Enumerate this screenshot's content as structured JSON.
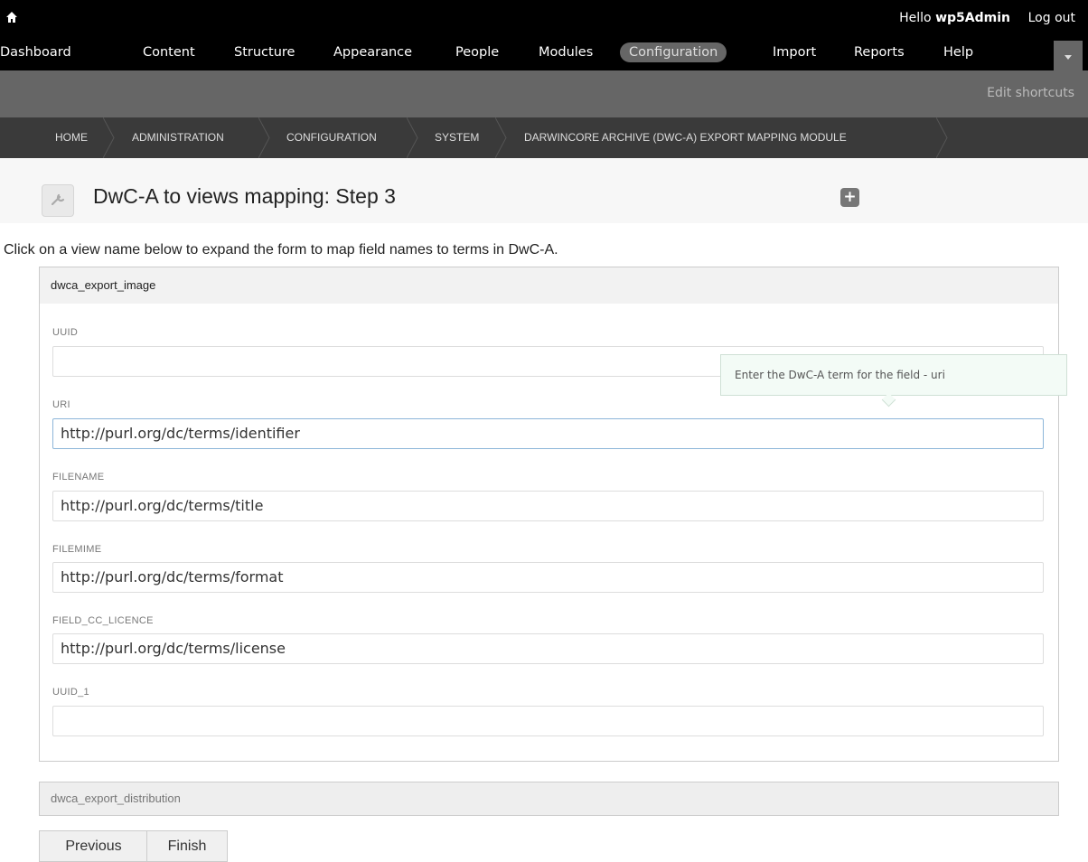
{
  "toolbar": {
    "hello_prefix": "Hello",
    "username": "wp5Admin",
    "logout": "Log out",
    "nav": [
      "Dashboard",
      "Content",
      "Structure",
      "Appearance",
      "People",
      "Modules",
      "Configuration",
      "Import",
      "Reports",
      "Help"
    ],
    "active_item": "Configuration",
    "edit_shortcuts": "Edit shortcuts"
  },
  "breadcrumb": [
    "HOME",
    "ADMINISTRATION",
    "CONFIGURATION",
    "SYSTEM",
    "DARWINCORE ARCHIVE (DWC-A) EXPORT MAPPING MODULE"
  ],
  "page": {
    "title": "DwC-A to views mapping: Step 3",
    "add_icon": "+",
    "intro": "Click on a view name below to expand the form to map field names to terms in DwC-A."
  },
  "fieldset": {
    "legend": "dwca_export_image",
    "fields": [
      {
        "label": "UUID",
        "value": ""
      },
      {
        "label": "URI",
        "value": "http://purl.org/dc/terms/identifier"
      },
      {
        "label": "FILENAME",
        "value": "http://purl.org/dc/terms/title"
      },
      {
        "label": "FILEMIME",
        "value": "http://purl.org/dc/terms/format"
      },
      {
        "label": "FIELD_CC_LICENCE",
        "value": "http://purl.org/dc/terms/license"
      },
      {
        "label": "UUID_1",
        "value": ""
      }
    ]
  },
  "tooltip": "Enter the DwC-A term for the field - uri",
  "collapsed_fieldset": "dwca_export_distribution",
  "buttons": {
    "previous": "Previous",
    "finish": "Finish"
  },
  "colors": {
    "toolbar_bg": "#000000",
    "shortcuts_bg": "#666666",
    "breadcrumb_bg": "#3a3a3a",
    "focus_border": "#8db6d9"
  }
}
